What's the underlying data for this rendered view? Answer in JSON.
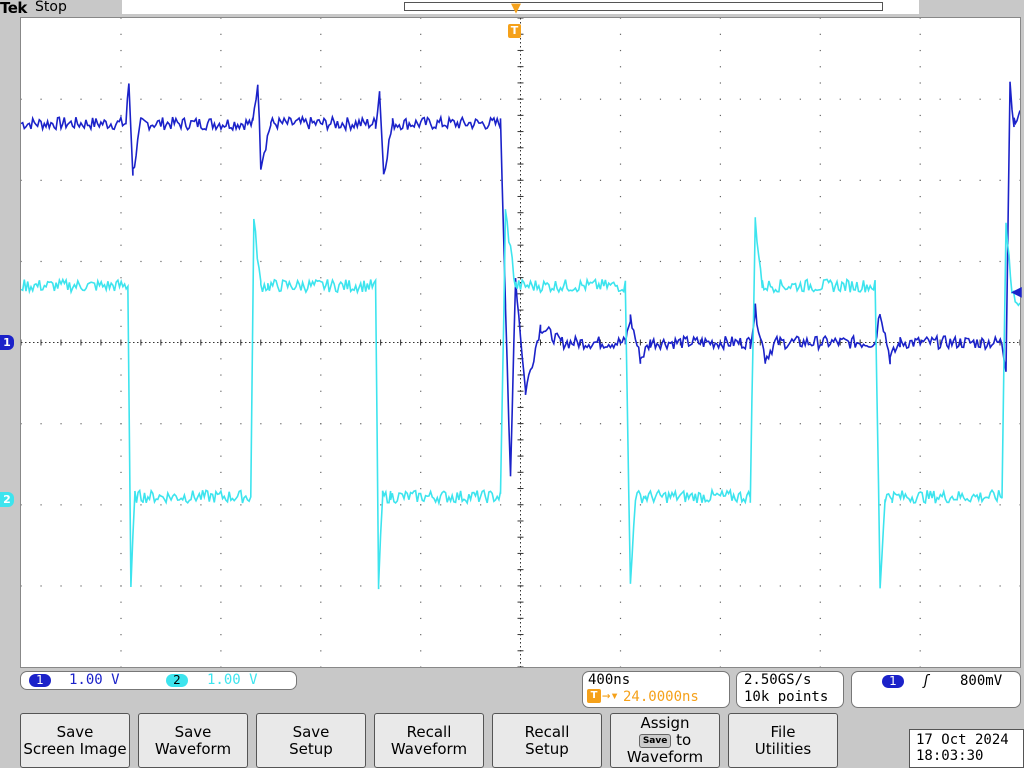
{
  "header": {
    "brand": "Tek",
    "acquisition_state": "Stop",
    "trigger_position_marker": "T"
  },
  "channels": [
    {
      "id": "1",
      "marker": "1",
      "scale": "1.00 V",
      "color": "#1b22c9"
    },
    {
      "id": "2",
      "marker": "2",
      "scale": "1.00 V",
      "color": "#3de4ee"
    }
  ],
  "colors": {
    "ch1": "#1b22c9",
    "ch2": "#3de4ee",
    "trigger": "#f5a11a",
    "graticule": "#000000"
  },
  "horizontal": {
    "scale": "400ns",
    "trigger_delay": "24.0000ns",
    "delay_icon": "trigger-delay-icon"
  },
  "acquisition": {
    "sample_rate": "2.50GS/s",
    "record_length": "10k points"
  },
  "trigger": {
    "source": "1",
    "slope_icon": "rising-edge-icon",
    "slope_glyph": "ʃ",
    "level": "800mV"
  },
  "softkeys": [
    {
      "line1": "Save",
      "line2": "Screen Image"
    },
    {
      "line1": "Save",
      "line2": "Waveform"
    },
    {
      "line1": "Save",
      "line2": "Setup"
    },
    {
      "line1": "Recall",
      "line2": "Waveform"
    },
    {
      "line1": "Recall",
      "line2": "Setup"
    },
    {
      "line1": "Assign",
      "key_label": "Save",
      "line2": "to",
      "line3": "Waveform"
    },
    {
      "line1": "File",
      "line2": "Utilities"
    }
  ],
  "datetime": {
    "date": "17 Oct  2024",
    "time": "18:03:30"
  },
  "chart_data": {
    "type": "line",
    "title": "",
    "xlabel": "",
    "ylabel": "",
    "grid": true,
    "divisions": {
      "x": 10,
      "y": 8
    },
    "x_unit": "divisions",
    "y_unit": "divisions",
    "xlim": [
      0,
      10
    ],
    "ylim": [
      -4,
      4
    ],
    "series": [
      {
        "name": "1",
        "description_points": [
          [
            0,
            2.7
          ],
          [
            1.05,
            2.7
          ],
          [
            1.08,
            3.2
          ],
          [
            1.12,
            2.1
          ],
          [
            1.2,
            2.7
          ],
          [
            2.32,
            2.7
          ],
          [
            2.37,
            3.2
          ],
          [
            2.4,
            2.2
          ],
          [
            2.5,
            2.7
          ],
          [
            3.55,
            2.7
          ],
          [
            3.59,
            3.1
          ],
          [
            3.63,
            2.1
          ],
          [
            3.72,
            2.7
          ],
          [
            4.8,
            2.7
          ],
          [
            4.85,
            0.5
          ],
          [
            4.9,
            -1.7
          ],
          [
            4.95,
            0.8
          ],
          [
            5.05,
            -0.6
          ],
          [
            5.2,
            0.2
          ],
          [
            5.4,
            0.0
          ],
          [
            6.05,
            0.0
          ],
          [
            6.1,
            0.3
          ],
          [
            6.2,
            -0.2
          ],
          [
            6.3,
            0.0
          ],
          [
            7.3,
            0.0
          ],
          [
            7.35,
            0.4
          ],
          [
            7.45,
            -0.2
          ],
          [
            7.55,
            0.0
          ],
          [
            8.55,
            0.0
          ],
          [
            8.6,
            0.4
          ],
          [
            8.7,
            -0.2
          ],
          [
            8.8,
            0.0
          ],
          [
            9.82,
            0.0
          ],
          [
            9.86,
            -0.3
          ],
          [
            9.9,
            3.2
          ],
          [
            9.94,
            2.7
          ],
          [
            10,
            2.8
          ]
        ]
      },
      {
        "name": "2",
        "description_points": [
          [
            0,
            0.7
          ],
          [
            1.07,
            0.7
          ],
          [
            1.1,
            -3.0
          ],
          [
            1.14,
            -1.9
          ],
          [
            1.22,
            -1.9
          ],
          [
            2.3,
            -1.9
          ],
          [
            2.33,
            1.5
          ],
          [
            2.4,
            0.7
          ],
          [
            2.47,
            0.7
          ],
          [
            3.55,
            0.7
          ],
          [
            3.58,
            -3.0
          ],
          [
            3.62,
            -1.9
          ],
          [
            3.7,
            -1.9
          ],
          [
            4.8,
            -1.9
          ],
          [
            4.85,
            1.6
          ],
          [
            4.95,
            0.7
          ],
          [
            6.05,
            0.7
          ],
          [
            6.1,
            -3.0
          ],
          [
            6.15,
            -1.9
          ],
          [
            6.25,
            -1.9
          ],
          [
            7.3,
            -1.9
          ],
          [
            7.35,
            1.5
          ],
          [
            7.42,
            0.7
          ],
          [
            8.55,
            0.7
          ],
          [
            8.6,
            -3.0
          ],
          [
            8.65,
            -1.9
          ],
          [
            8.72,
            -1.9
          ],
          [
            9.82,
            -1.9
          ],
          [
            9.86,
            1.5
          ],
          [
            9.92,
            0.6
          ],
          [
            10,
            0.5
          ]
        ]
      }
    ]
  }
}
